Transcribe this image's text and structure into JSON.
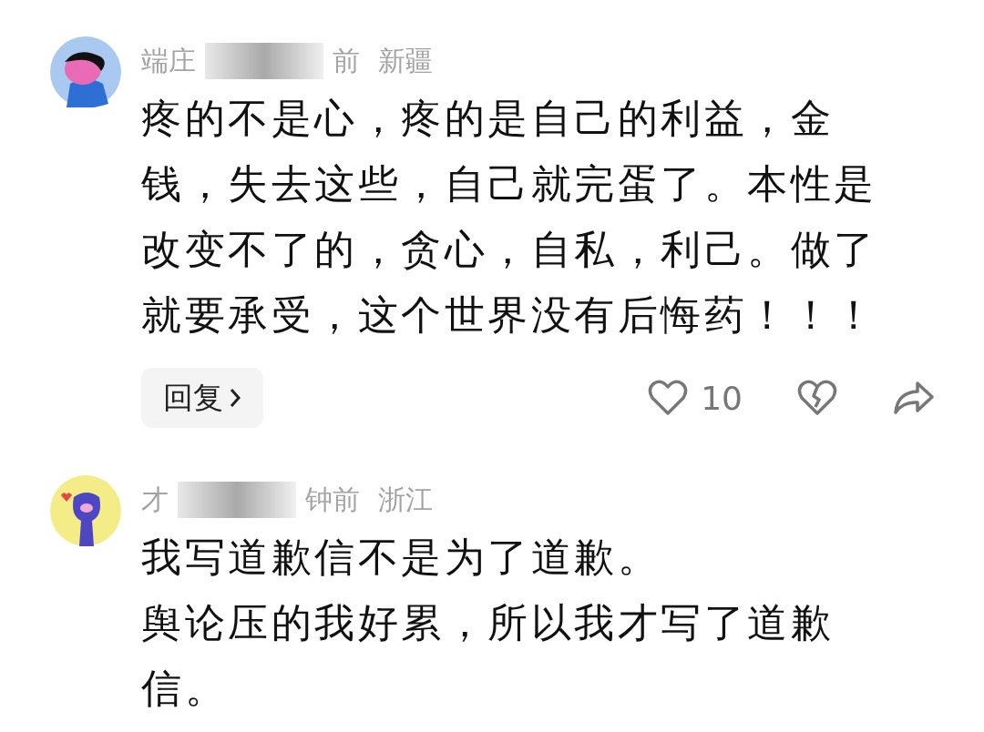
{
  "comments": [
    {
      "avatar": {
        "kind": "dog"
      },
      "name": "端庄",
      "time": "前",
      "location": "新疆",
      "paragraphs": [
        "疼的不是心，疼的是自己的利益，金钱，失去这些，自己就完蛋了。本性是改变不了的，贪心，自私，利己。做了就要承受，这个世界没有后悔药！！！"
      ],
      "reply": "回复",
      "likes": "10"
    },
    {
      "avatar": {
        "kind": "paw"
      },
      "name": "才",
      "time": "钟前",
      "location": "浙江",
      "paragraphs": [
        "我写道歉信不是为了道歉。",
        "舆论压的我好累，所以我才写了道歉信。"
      ]
    }
  ]
}
